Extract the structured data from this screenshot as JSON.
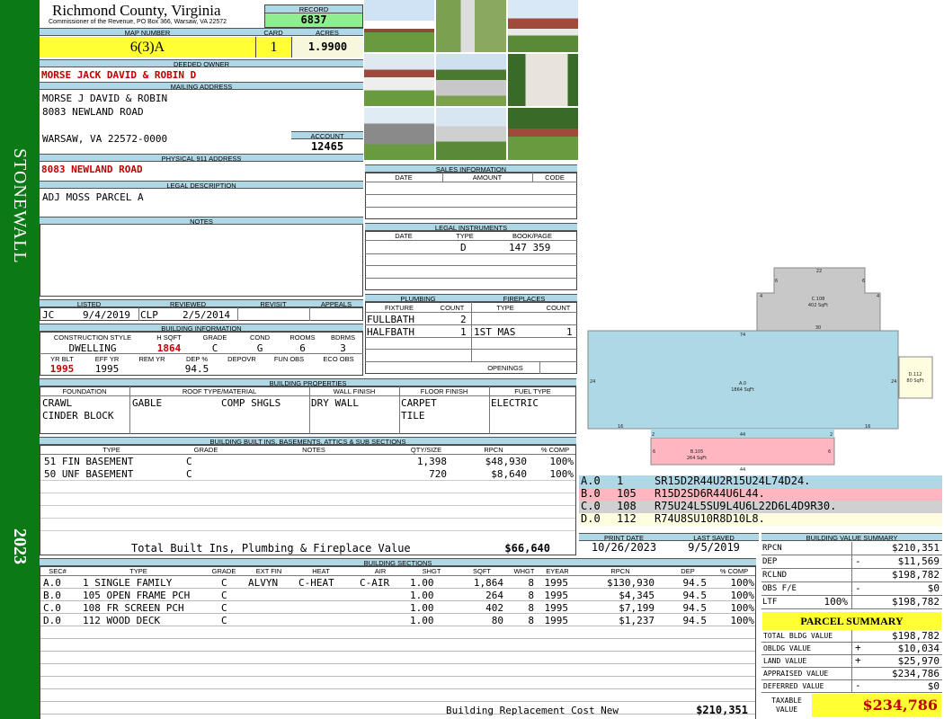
{
  "county": {
    "name": "Richmond County, Virginia",
    "commissioner": "Commissioner of the Revenue, PO Box 366, Warsaw, VA 22572"
  },
  "sidebar": {
    "district": "STONEWALL",
    "year": "2023"
  },
  "record": {
    "label": "RECORD",
    "value": "6837"
  },
  "map": {
    "label": "MAP NUMBER",
    "value": "6(3)A",
    "card_label": "CARD",
    "card": "1",
    "acres_label": "ACRES",
    "acres": "1.9900"
  },
  "owner": {
    "label": "DEEDED OWNER",
    "value": "MORSE JACK DAVID & ROBIN D"
  },
  "mailing": {
    "label": "MAILING ADDRESS",
    "line1": "MORSE J DAVID & ROBIN",
    "line2": "8083 NEWLAND ROAD",
    "line3": "WARSAW, VA 22572-0000",
    "account_label": "ACCOUNT",
    "account": "12465"
  },
  "physical": {
    "label": "PHYSICAL 911 ADDRESS",
    "value": "8083 NEWLAND ROAD"
  },
  "legal": {
    "label": "LEGAL DESCRIPTION",
    "value": "ADJ MOSS PARCEL A"
  },
  "notes": {
    "label": "NOTES"
  },
  "sales": {
    "label": "SALES INFORMATION",
    "cols": [
      "DATE",
      "AMOUNT",
      "CODE"
    ]
  },
  "instruments": {
    "label": "LEGAL INSTRUMENTS",
    "cols": [
      "DATE",
      "TYPE",
      "BOOK/PAGE"
    ],
    "type": "D",
    "bookpage": "147 359"
  },
  "listed": {
    "labels": [
      "LISTED",
      "REVIEWED",
      "REVISIT",
      "APPEALS"
    ],
    "by": "JC",
    "date": "9/4/2019",
    "rev_by": "CLP",
    "rev_date": "2/5/2014"
  },
  "building_info": {
    "label": "BUILDING INFORMATION",
    "cols": [
      "CONSTRUCTION STYLE",
      "H SQFT",
      "GRADE",
      "COND",
      "ROOMS",
      "BDRMS"
    ],
    "vals": [
      "DWELLING",
      "1864",
      "C",
      "G",
      "6",
      "3"
    ],
    "cols2": [
      "YR BLT",
      "EFF YR",
      "REM YR",
      "DEP %",
      "DEPOVR",
      "FUN OBS",
      "ECO OBS"
    ],
    "vals2": [
      "1995",
      "1995",
      "",
      "94.5",
      "",
      "",
      ""
    ]
  },
  "plumbing": {
    "label": "PLUMBING",
    "cols": [
      "FIXTURE",
      "COUNT"
    ],
    "rows": [
      [
        "FULLBATH",
        "2"
      ],
      [
        "HALFBATH",
        "1"
      ]
    ]
  },
  "fireplaces": {
    "label": "FIREPLACES",
    "cols": [
      "TYPE",
      "COUNT"
    ],
    "rows": [
      [
        "1ST MAS",
        "1"
      ]
    ],
    "openings": "OPENINGS"
  },
  "properties": {
    "label": "BUILDING PROPERTIES",
    "cols": [
      "FOUNDATION",
      "ROOF TYPE/MATERIAL",
      "WALL FINISH",
      "FLOOR FINISH",
      "FUEL TYPE"
    ],
    "foundation": [
      "CRAWL",
      "CINDER BLOCK"
    ],
    "roof_type": "GABLE",
    "roof_mat": "COMP SHGLS",
    "wall": "DRY WALL",
    "floor": [
      "CARPET",
      "TILE"
    ],
    "fuel": "ELECTRIC"
  },
  "builtins": {
    "label": "BUILDING BUILT INS, BASEMENTS, ATTICS & SUB SECTIONS",
    "cols": [
      "TYPE",
      "GRADE",
      "NOTES",
      "QTY/SIZE",
      "RPCN",
      "% COMP"
    ],
    "rows": [
      {
        "type": "51 FIN BASEMENT",
        "grade": "C",
        "qty": "1,398",
        "rpcn": "$48,930",
        "comp": "100%"
      },
      {
        "type": "50 UNF BASEMENT",
        "grade": "C",
        "qty": "720",
        "rpcn": "$8,640",
        "comp": "100%"
      }
    ],
    "total_label": "Total Built Ins, Plumbing & Fireplace Value",
    "total": "$66,640"
  },
  "sections": {
    "label": "BUILDING SECTIONS",
    "cols": [
      "SEC#",
      "TYPE",
      "GRADE",
      "EXT FIN",
      "HEAT",
      "AIR",
      "SHGT",
      "SQFT",
      "WHGT",
      "EYEAR",
      "RPCN",
      "DEP",
      "% COMP"
    ],
    "rows": [
      [
        "A.0",
        "1 SINGLE FAMILY",
        "C",
        "ALVYN",
        "C-HEAT",
        "C-AIR",
        "1.00",
        "1,864",
        "8",
        "1995",
        "$130,930",
        "94.5",
        "100%"
      ],
      [
        "B.0",
        "105 OPEN FRAME PCH",
        "C",
        "",
        "",
        "",
        "1.00",
        "264",
        "8",
        "1995",
        "$4,345",
        "94.5",
        "100%"
      ],
      [
        "C.0",
        "108 FR SCREEN PCH",
        "C",
        "",
        "",
        "",
        "1.00",
        "402",
        "8",
        "1995",
        "$7,199",
        "94.5",
        "100%"
      ],
      [
        "D.0",
        "112 WOOD DECK",
        "C",
        "",
        "",
        "",
        "1.00",
        "80",
        "8",
        "1995",
        "$1,237",
        "94.5",
        "100%"
      ]
    ],
    "replacement_label": "Building Replacement Cost New",
    "replacement": "$210,351"
  },
  "sketch": {
    "labels": {
      "a": "A.0",
      "a_area": "1864 SqFt",
      "b": "B.105",
      "b_area": "264 SqFt",
      "c": "C.108",
      "c_area": "402 SqFt",
      "d": "D.112",
      "d_area": "80 SqFt"
    },
    "dims": [
      "22",
      "6",
      "6",
      "4",
      "4",
      "30",
      "74",
      "24",
      "24",
      "16",
      "16",
      "2",
      "2",
      "44",
      "44",
      "6",
      "6"
    ],
    "colors": {
      "a": "#add8e6",
      "b": "#ffb6c1",
      "c": "#c8c8c8",
      "d": "#fffde0"
    },
    "codes": [
      {
        "sec": "A.0",
        "num": "1",
        "code": "SR15D2R44U2R15U24L74D24.",
        "color": "#add8e6"
      },
      {
        "sec": "B.0",
        "num": "105",
        "code": "R15D2SD6R44U6L44.",
        "color": "#ffb6c1"
      },
      {
        "sec": "C.0",
        "num": "108",
        "code": "R75U24L5SU9L4U6L22D6L4D9R30.",
        "color": "#d0d0d0"
      },
      {
        "sec": "D.0",
        "num": "112",
        "code": "R74U8SU10R8D10L8.",
        "color": "#fffde0"
      }
    ]
  },
  "dates": {
    "print_label": "PRINT DATE",
    "print": "10/26/2023",
    "saved_label": "LAST SAVED",
    "saved": "9/5/2019"
  },
  "value_summary": {
    "label": "BUILDING VALUE SUMMARY",
    "rows": [
      {
        "label": "RPCN",
        "sign": "",
        "value": "$210,351"
      },
      {
        "label": "DEP",
        "sign": "-",
        "value": "$11,569"
      },
      {
        "label": "RCLND",
        "sign": "",
        "value": "$198,782"
      },
      {
        "label": "OBS F/E",
        "sign": "-",
        "value": "$0"
      },
      {
        "label": "LTF",
        "pct": "100%",
        "sign": "",
        "value": "$198,782"
      }
    ]
  },
  "parcel": {
    "label": "PARCEL SUMMARY",
    "rows": [
      {
        "label": "TOTAL BLDG VALUE",
        "sign": "",
        "value": "$198,782"
      },
      {
        "label": "OBLDG VALUE",
        "sign": "+",
        "value": "$10,034"
      },
      {
        "label": "LAND VALUE",
        "sign": "+",
        "value": "$25,970"
      },
      {
        "label": "APPRAISED VALUE",
        "sign": "",
        "value": "$234,786"
      },
      {
        "label": "DEFERRED VALUE",
        "sign": "-",
        "value": "$0"
      }
    ],
    "taxable_label": "TAXABLE VALUE",
    "taxable": "$234,786"
  },
  "photos": [
    "house-front",
    "mailbox-post",
    "house-side",
    "house-yard",
    "fence-pool",
    "shed",
    "gazebo",
    "house-rear",
    "house-far"
  ]
}
